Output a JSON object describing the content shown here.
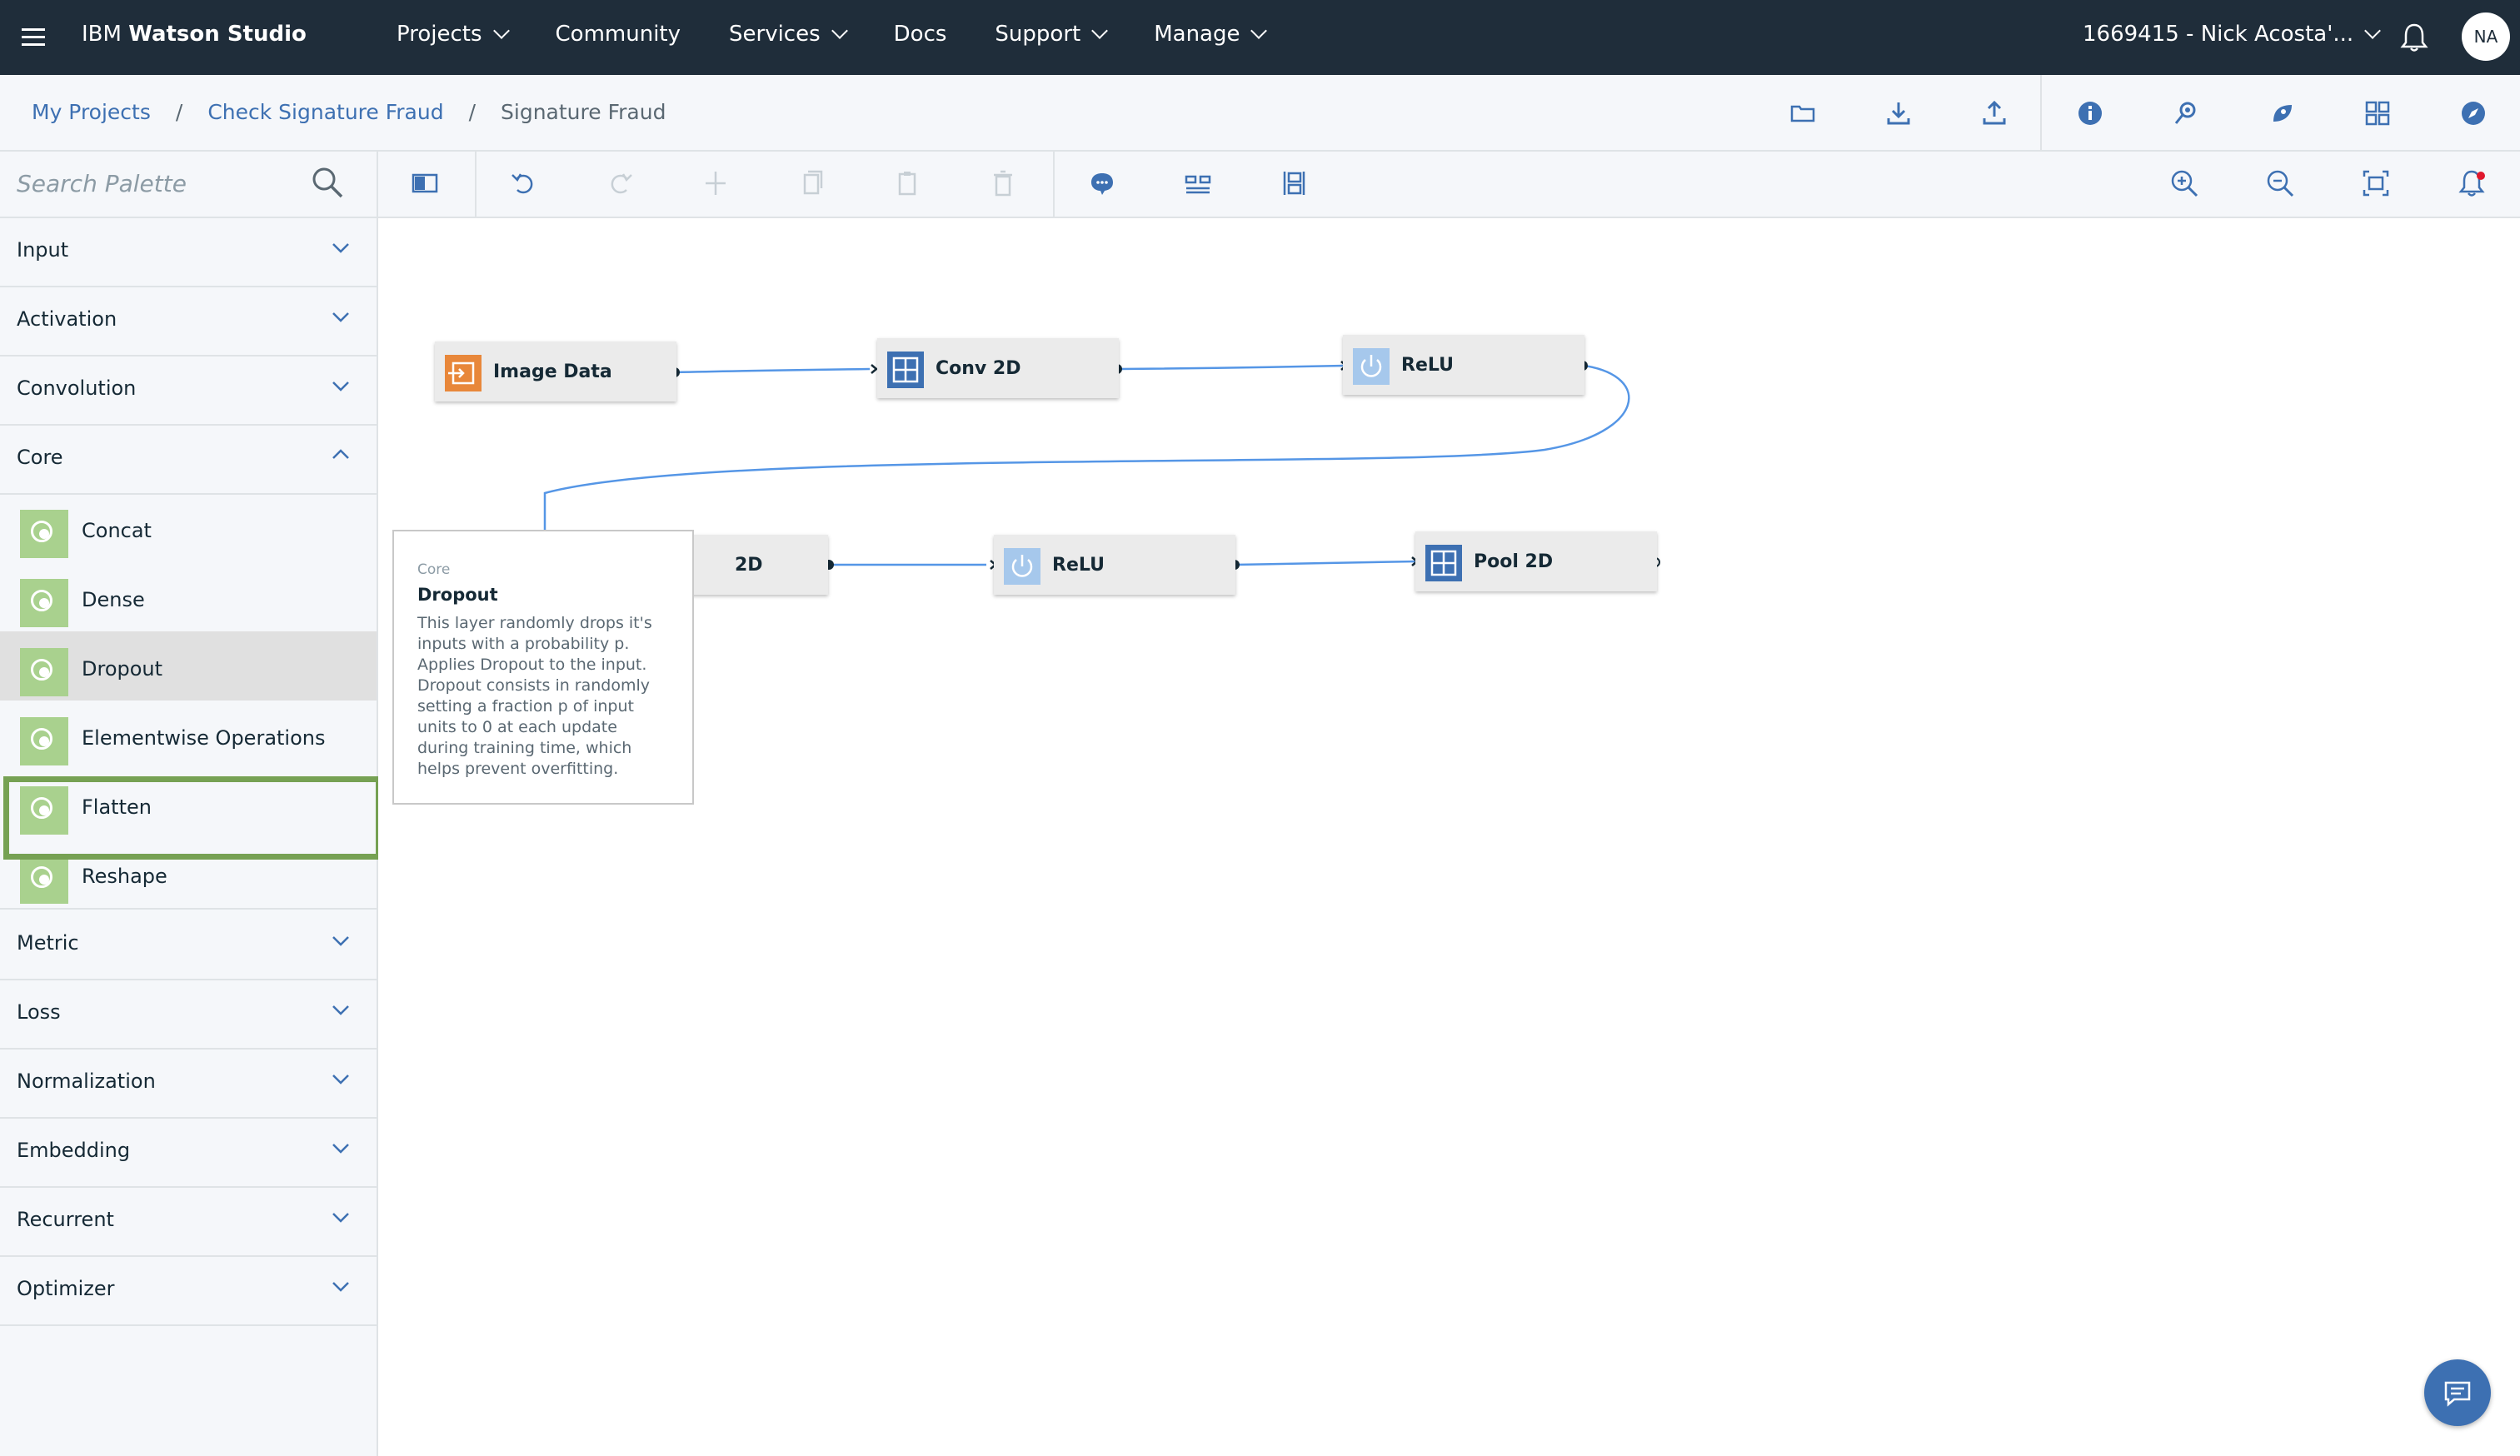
{
  "topbar": {
    "brand_prefix": "IBM",
    "brand_name": "Watson Studio",
    "nav": [
      {
        "label": "Projects"
      },
      {
        "label": "Community"
      },
      {
        "label": "Services"
      },
      {
        "label": "Docs"
      },
      {
        "label": "Support"
      },
      {
        "label": "Manage"
      }
    ],
    "account": "1669415 - Nick Acosta'...",
    "avatar": "NA"
  },
  "breadcrumb": {
    "items": [
      "My Projects",
      "Check Signature Fraud",
      "Signature Fraud"
    ],
    "separator": "/"
  },
  "palette": {
    "search_placeholder": "Search Palette",
    "categories": [
      {
        "label": "Input"
      },
      {
        "label": "Activation"
      },
      {
        "label": "Convolution"
      },
      {
        "label": "Core"
      },
      {
        "label": "Metric"
      },
      {
        "label": "Loss"
      },
      {
        "label": "Normalization"
      },
      {
        "label": "Embedding"
      },
      {
        "label": "Recurrent"
      },
      {
        "label": "Optimizer"
      }
    ],
    "core_items": [
      {
        "label": "Concat"
      },
      {
        "label": "Dense"
      },
      {
        "label": "Dropout"
      },
      {
        "label": "Elementwise Operations"
      },
      {
        "label": "Flatten"
      },
      {
        "label": "Reshape"
      }
    ],
    "selected": "Dropout"
  },
  "canvas": {
    "nodes": [
      {
        "label": "Image Data",
        "icon": "input-icon"
      },
      {
        "label": "Conv 2D",
        "icon": "grid-icon"
      },
      {
        "label": "ReLU",
        "icon": "power-icon"
      },
      {
        "label": "2D",
        "icon": "grid-icon"
      },
      {
        "label": "ReLU",
        "icon": "power-icon"
      },
      {
        "label": "Pool 2D",
        "icon": "grid-icon"
      }
    ]
  },
  "tooltip": {
    "category": "Core",
    "title": "Dropout",
    "description": "This layer randomly drops it's inputs with a probability p. Applies Dropout to the input. Dropout consists in randomly setting a fraction p of input units to 0 at each update during training time, which helps prevent overfitting."
  },
  "colors": {
    "topbar": "#1f2d3a",
    "accent": "#3d70b2",
    "selected_outline": "#76a153",
    "palette_icon": "#a9d18e",
    "input_node": "#e8873a"
  }
}
